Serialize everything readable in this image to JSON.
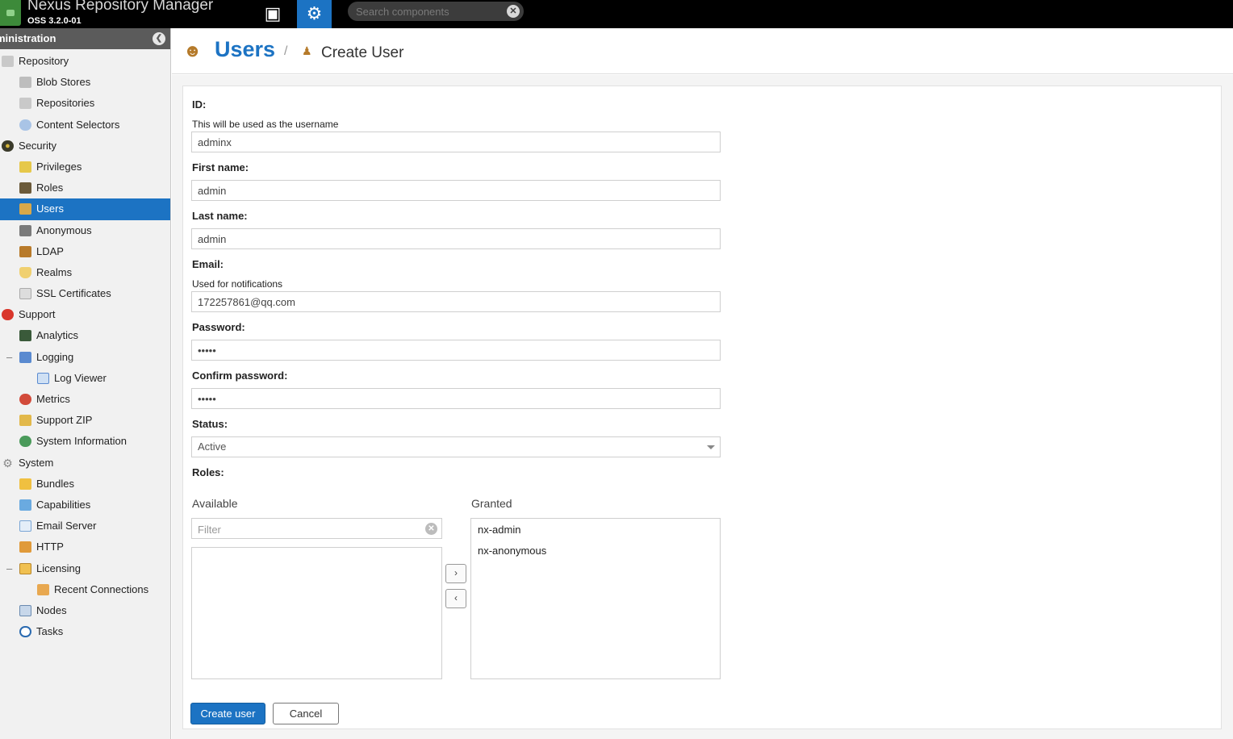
{
  "header": {
    "app_title": "Nexus Repository Manager",
    "version": "OSS 3.2.0-01",
    "browse_icon": "cube-icon",
    "admin_icon": "gear-icon",
    "search_placeholder": "Search components"
  },
  "sidebar": {
    "heading": "ministration",
    "items": [
      {
        "label": "Repository",
        "icon": "database-icon"
      },
      {
        "label": "Blob Stores",
        "icon": "hard-drive-icon"
      },
      {
        "label": "Repositories",
        "icon": "database-icon"
      },
      {
        "label": "Content Selectors",
        "icon": "selector-icon"
      },
      {
        "label": "Security",
        "icon": "eye-icon"
      },
      {
        "label": "Privileges",
        "icon": "medal-icon"
      },
      {
        "label": "Roles",
        "icon": "role-user-icon"
      },
      {
        "label": "Users",
        "icon": "users-icon"
      },
      {
        "label": "Anonymous",
        "icon": "anonymous-user-icon"
      },
      {
        "label": "LDAP",
        "icon": "address-book-icon"
      },
      {
        "label": "Realms",
        "icon": "shield-icon"
      },
      {
        "label": "SSL Certificates",
        "icon": "certificate-icon"
      },
      {
        "label": "Support",
        "icon": "lifebuoy-icon"
      },
      {
        "label": "Analytics",
        "icon": "chart-icon"
      },
      {
        "label": "Logging",
        "icon": "log-icon"
      },
      {
        "label": "Log Viewer",
        "icon": "log-viewer-icon"
      },
      {
        "label": "Metrics",
        "icon": "pie-chart-icon"
      },
      {
        "label": "Support ZIP",
        "icon": "zip-icon"
      },
      {
        "label": "System Information",
        "icon": "globe-icon"
      },
      {
        "label": "System",
        "icon": "cog-icon"
      },
      {
        "label": "Bundles",
        "icon": "puzzle-icon"
      },
      {
        "label": "Capabilities",
        "icon": "capability-icon"
      },
      {
        "label": "Email Server",
        "icon": "envelope-icon"
      },
      {
        "label": "HTTP",
        "icon": "truck-icon"
      },
      {
        "label": "Licensing",
        "icon": "license-icon"
      },
      {
        "label": "Recent Connections",
        "icon": "connections-icon"
      },
      {
        "label": "Nodes",
        "icon": "nodes-icon"
      },
      {
        "label": "Tasks",
        "icon": "clock-icon"
      }
    ]
  },
  "breadcrumb": {
    "title": "Users",
    "separator": "/",
    "current": "Create User"
  },
  "form": {
    "id_label": "ID:",
    "id_help": "This will be used as the username",
    "id_value": "adminx",
    "first_name_label": "First name:",
    "first_name_value": "admin",
    "last_name_label": "Last name:",
    "last_name_value": "admin",
    "email_label": "Email:",
    "email_help": "Used for notifications",
    "email_value": "172257861@qq.com",
    "password_label": "Password:",
    "password_value": "•••••",
    "confirm_password_label": "Confirm password:",
    "confirm_password_value": "•••••",
    "status_label": "Status:",
    "status_value": "Active",
    "roles_label": "Roles:",
    "available_label": "Available",
    "granted_label": "Granted",
    "filter_placeholder": "Filter",
    "available_roles": [],
    "granted_roles": [
      "nx-admin",
      "nx-anonymous"
    ],
    "add_role_symbol": "›",
    "remove_role_symbol": "‹",
    "create_button": "Create user",
    "cancel_button": "Cancel"
  }
}
